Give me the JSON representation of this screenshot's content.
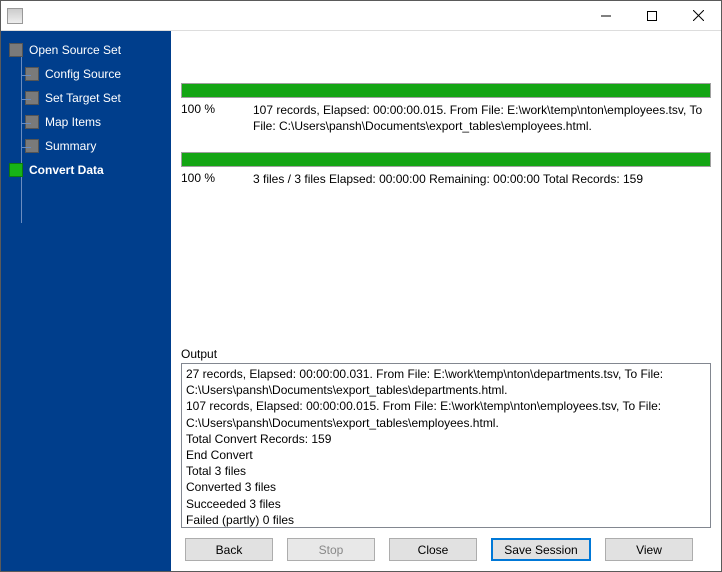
{
  "window": {
    "title": ""
  },
  "sidebar": {
    "items": [
      {
        "label": "Open Source Set",
        "level": "root",
        "active": false
      },
      {
        "label": "Config Source",
        "level": "child",
        "active": false
      },
      {
        "label": "Set Target Set",
        "level": "child",
        "active": false
      },
      {
        "label": "Map Items",
        "level": "child",
        "active": false
      },
      {
        "label": "Summary",
        "level": "child",
        "active": false
      },
      {
        "label": "Convert Data",
        "level": "root",
        "active": true
      }
    ]
  },
  "progress": {
    "file": {
      "percent_label": "100 %",
      "text": "107 records,    Elapsed: 00:00:00.015.    From File: E:\\work\\temp\\nton\\employees.tsv,    To File: C:\\Users\\pansh\\Documents\\export_tables\\employees.html."
    },
    "overall": {
      "percent_label": "100 %",
      "text": "3 files / 3 files    Elapsed: 00:00:00    Remaining: 00:00:00    Total Records: 159"
    }
  },
  "output": {
    "label": "Output",
    "lines": [
      "27 records,    Elapsed: 00:00:00.031.    From File: E:\\work\\temp\\nton\\departments.tsv,    To File: C:\\Users\\pansh\\Documents\\export_tables\\departments.html.",
      "107 records,    Elapsed: 00:00:00.015.    From File: E:\\work\\temp\\nton\\employees.tsv,    To File: C:\\Users\\pansh\\Documents\\export_tables\\employees.html.",
      "Total Convert Records: 159",
      "End Convert",
      "Total 3 files",
      "Converted 3 files",
      "Succeeded 3 files",
      "Failed (partly) 0 files"
    ]
  },
  "buttons": {
    "back": "Back",
    "stop": "Stop",
    "close": "Close",
    "save_session": "Save Session",
    "view": "View"
  }
}
